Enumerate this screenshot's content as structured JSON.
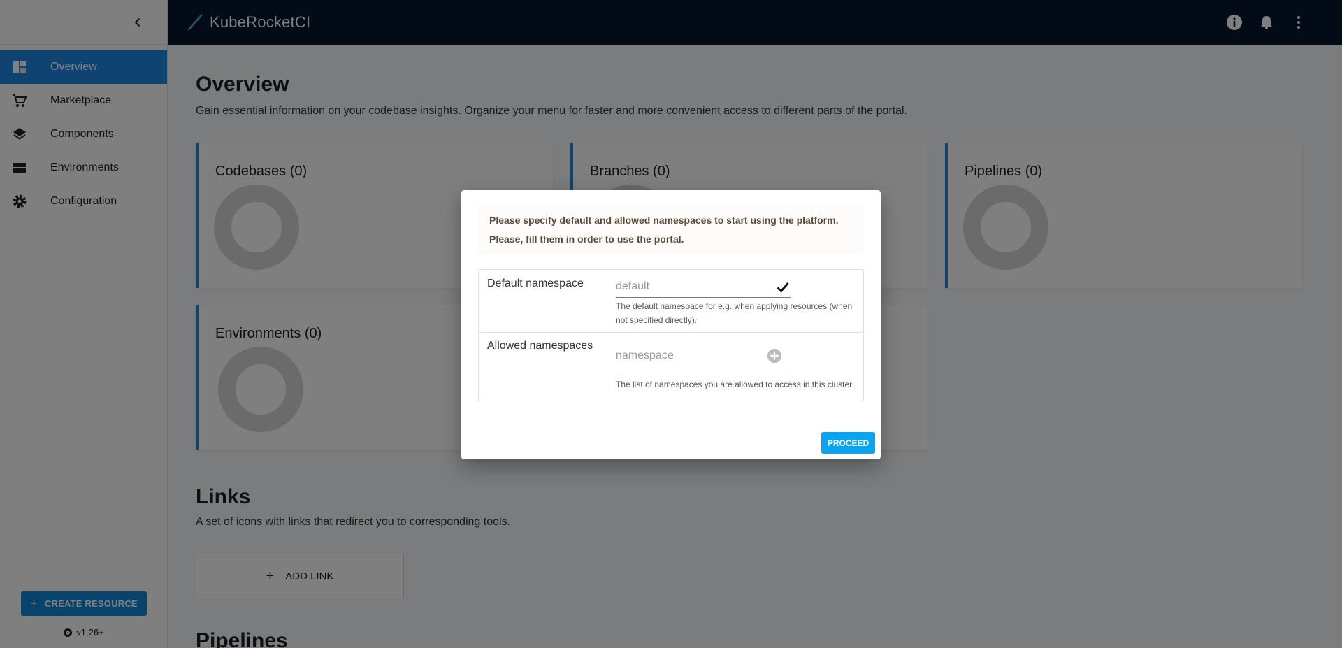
{
  "app": {
    "title": "KubeRocketCI"
  },
  "sidebar": {
    "items": [
      {
        "label": "Overview",
        "icon": "dashboard-icon",
        "active": true
      },
      {
        "label": "Marketplace",
        "icon": "cart-icon",
        "active": false
      },
      {
        "label": "Components",
        "icon": "layers-icon",
        "active": false
      },
      {
        "label": "Environments",
        "icon": "storage-icon",
        "active": false
      },
      {
        "label": "Configuration",
        "icon": "gear-icon",
        "active": false
      }
    ],
    "create_label": "CREATE RESOURCE",
    "version": "v1.26+"
  },
  "main": {
    "title": "Overview",
    "description": "Gain essential information on your codebase insights. Organize your menu for faster and more convenient access to different parts of the portal.",
    "cards": [
      {
        "title": "Codebases (0)"
      },
      {
        "title": "Branches (0)"
      },
      {
        "title": "Pipelines (0)"
      },
      {
        "title": "Environments (0)"
      }
    ],
    "links": {
      "title": "Links",
      "description": "A set of icons with links that redirect you to corresponding tools.",
      "add_label": "ADD LINK"
    },
    "pipelines_title": "Pipelines"
  },
  "dialog": {
    "notice_line1": "Please specify default and allowed namespaces to start using the platform.",
    "notice_line2": "Please, fill them in order to use the portal.",
    "default_ns": {
      "label": "Default namespace",
      "value": "default",
      "helper": "The default namespace for e.g. when applying resources (when not specified directly)."
    },
    "allowed_ns": {
      "label": "Allowed namespaces",
      "placeholder": "namespace",
      "helper": "The list of namespaces you are allowed to access in this cluster."
    },
    "proceed_label": "PROCEED"
  },
  "colors": {
    "header_bg": "#06172d",
    "accent": "#1e88e5",
    "proceed": "#0aa3ef"
  }
}
